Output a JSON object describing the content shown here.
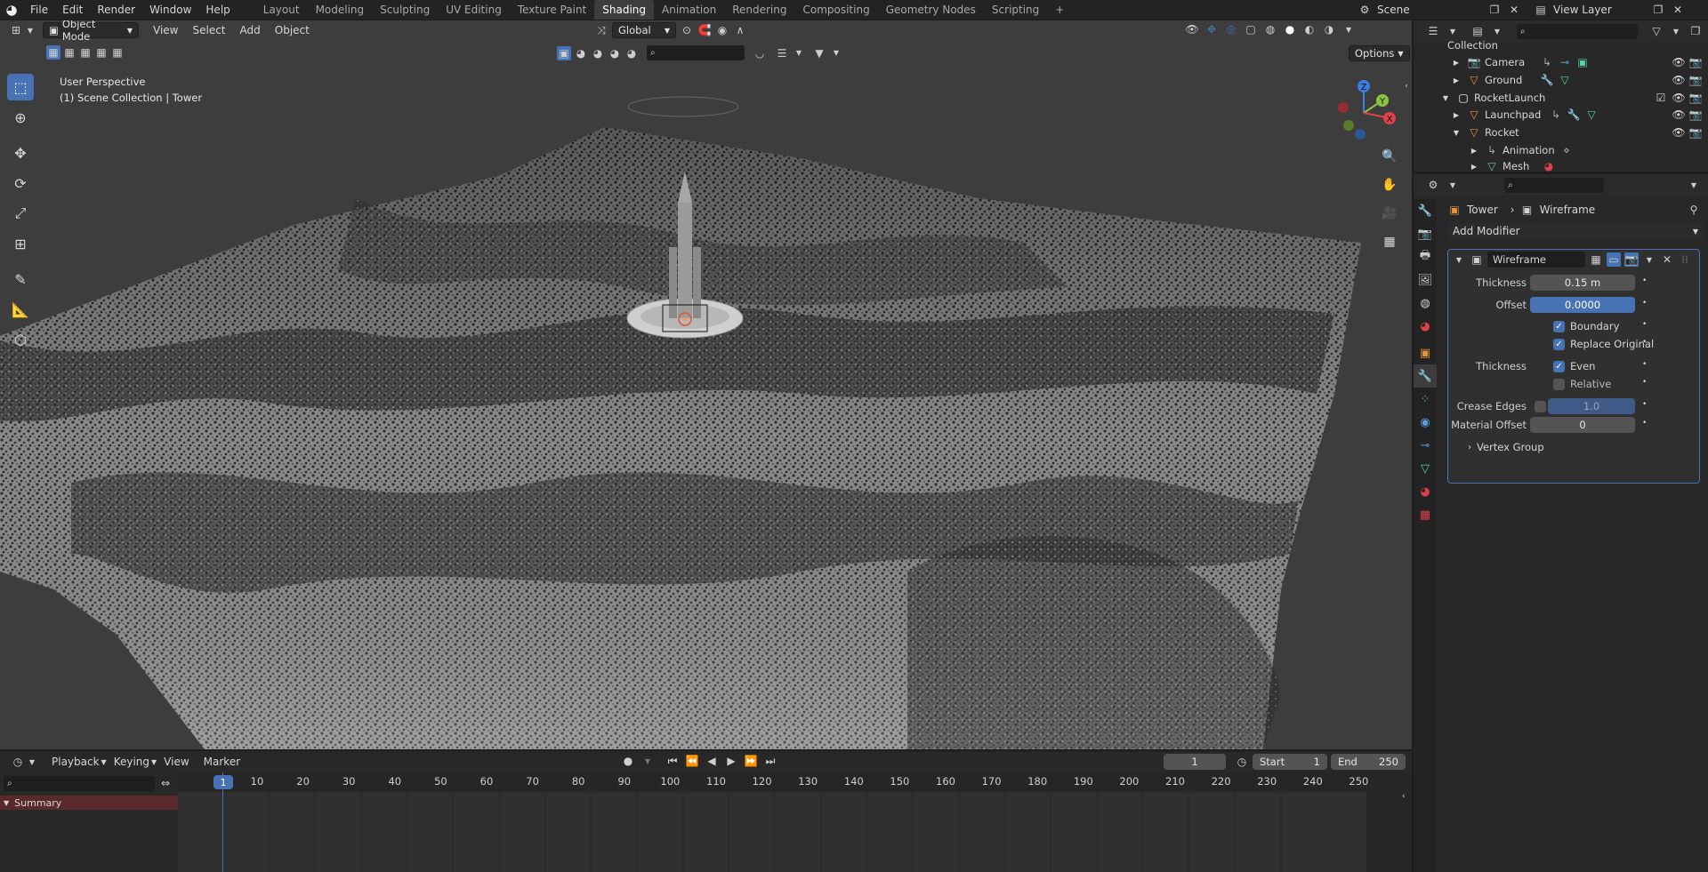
{
  "topbar": {
    "menus": [
      "File",
      "Edit",
      "Render",
      "Window",
      "Help"
    ],
    "workspaces": [
      "Layout",
      "Modeling",
      "Sculpting",
      "UV Editing",
      "Texture Paint",
      "Shading",
      "Animation",
      "Rendering",
      "Compositing",
      "Geometry Nodes",
      "Scripting"
    ],
    "active_workspace": "Shading",
    "scene_label": "Scene",
    "view_layer_label": "View Layer"
  },
  "viewport": {
    "mode": "Object Mode",
    "menus": [
      "View",
      "Select",
      "Add",
      "Object"
    ],
    "transform_orientation": "Global",
    "options_label": "Options",
    "info_line1": "User Perspective",
    "info_line2": "(1) Scene Collection | Tower",
    "gizmo_axes": {
      "z": "Z",
      "y": "Y",
      "x": "X"
    }
  },
  "outliner": {
    "rows": [
      {
        "label": "Collection",
        "icon": "collection-icon"
      },
      {
        "label": "Camera",
        "icon": "camera-icon"
      },
      {
        "label": "Ground",
        "icon": "mesh-object-icon"
      },
      {
        "label": "RocketLaunch",
        "icon": "collection-icon"
      },
      {
        "label": "Launchpad",
        "icon": "mesh-object-icon"
      },
      {
        "label": "Rocket",
        "icon": "mesh-object-icon"
      },
      {
        "label": "Animation",
        "icon": "animation-icon"
      },
      {
        "label": "Mesh",
        "icon": "mesh-data-icon"
      }
    ]
  },
  "properties": {
    "breadcrumb_object": "Tower",
    "breadcrumb_modifier": "Wireframe",
    "add_modifier_label": "Add Modifier",
    "modifier_name": "Wireframe",
    "thickness_label": "Thickness",
    "thickness_value": "0.15 m",
    "offset_label": "Offset",
    "offset_value": "0.0000",
    "boundary_label": "Boundary",
    "replace_original_label": "Replace Original",
    "thickness2_label": "Thickness",
    "even_label": "Even",
    "relative_label": "Relative",
    "crease_edges_label": "Crease Edges",
    "crease_value": "1.0",
    "material_offset_label": "Material Offset",
    "material_offset_value": "0",
    "vertex_group_label": "Vertex Group"
  },
  "timeline": {
    "menus": [
      "Playback",
      "Keying",
      "View",
      "Marker"
    ],
    "current_frame": "1",
    "start_label": "Start",
    "start_value": "1",
    "end_label": "End",
    "end_value": "250",
    "summary_label": "Summary",
    "playhead_label": "1",
    "frame_ticks": [
      "10",
      "20",
      "30",
      "40",
      "50",
      "60",
      "70",
      "80",
      "90",
      "100",
      "110",
      "120",
      "130",
      "140",
      "150",
      "160",
      "170",
      "180",
      "190",
      "200",
      "210",
      "220",
      "230",
      "240",
      "250"
    ]
  },
  "colors": {
    "accent": "#4772b3",
    "axis_x": "#e0404c",
    "axis_y": "#8bc23e",
    "axis_z": "#3b7fe0",
    "object_orange": "#e5933b"
  }
}
